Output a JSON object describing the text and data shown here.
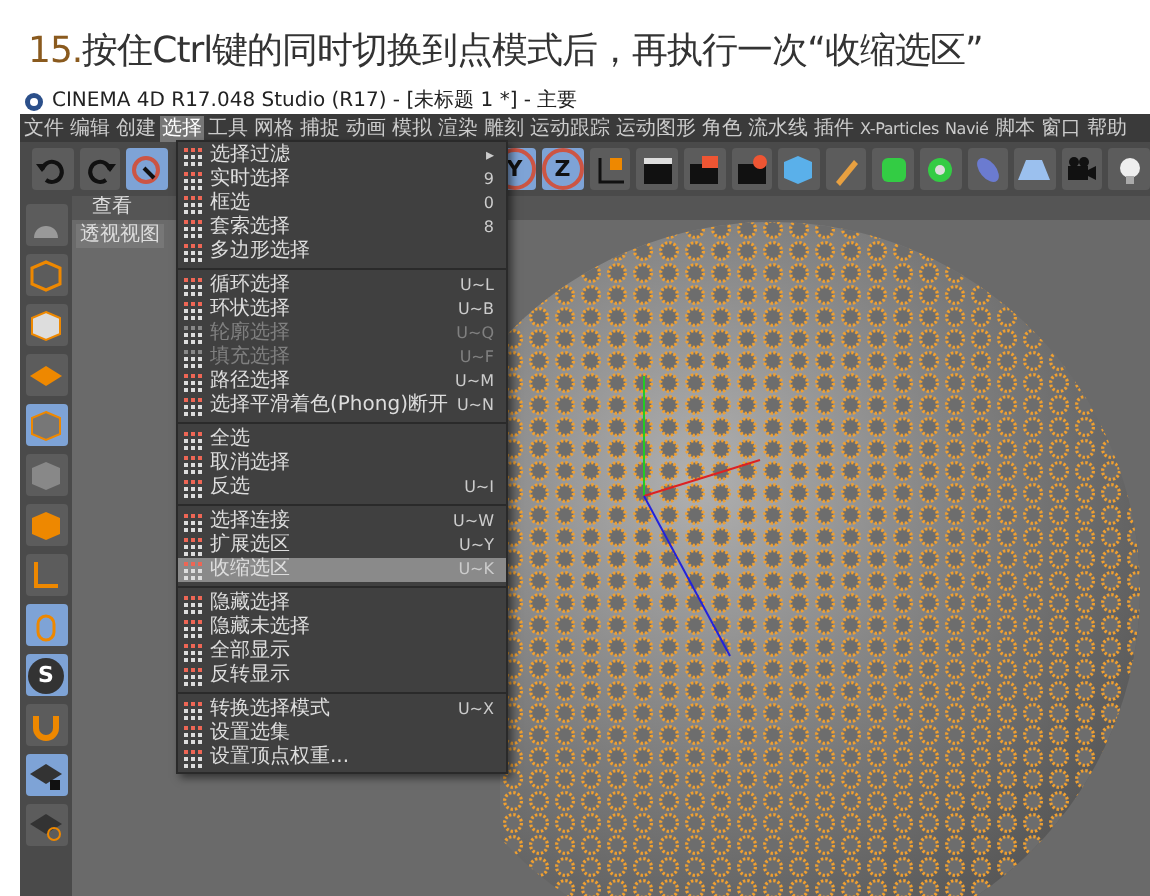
{
  "heading": {
    "step_number": "15.",
    "text": "按住Ctrl键的同时切换到点模式后，再执行一次“收缩选区”"
  },
  "window": {
    "title": "CINEMA 4D R17.048 Studio (R17) - [未标题 1 *] - 主要"
  },
  "menubar": [
    {
      "label": "文件",
      "selected": false
    },
    {
      "label": "编辑",
      "selected": false
    },
    {
      "label": "创建",
      "selected": false
    },
    {
      "label": "选择",
      "selected": true
    },
    {
      "label": "工具",
      "selected": false
    },
    {
      "label": "网格",
      "selected": false
    },
    {
      "label": "捕捉",
      "selected": false
    },
    {
      "label": "动画",
      "selected": false
    },
    {
      "label": "模拟",
      "selected": false
    },
    {
      "label": "渲染",
      "selected": false
    },
    {
      "label": "雕刻",
      "selected": false
    },
    {
      "label": "运动跟踪",
      "selected": false
    },
    {
      "label": "运动图形",
      "selected": false
    },
    {
      "label": "角色",
      "selected": false
    },
    {
      "label": "流水线",
      "selected": false
    },
    {
      "label": "插件",
      "selected": false
    },
    {
      "label": "X-Particles",
      "selected": false
    },
    {
      "label": "Navié",
      "selected": false
    },
    {
      "label": "脚本",
      "selected": false
    },
    {
      "label": "窗口",
      "selected": false
    },
    {
      "label": "帮助",
      "selected": false
    }
  ],
  "viewport": {
    "tab": "查看",
    "label": "透视视图"
  },
  "toolbar": {
    "axis_letters": [
      "Y",
      "Z"
    ]
  },
  "tools": {
    "snap_letter": "S"
  },
  "menu": [
    [
      {
        "label": "选择过滤",
        "shortcut": "▸",
        "disabled": false,
        "selected": false
      },
      {
        "label": "实时选择",
        "shortcut": "9",
        "disabled": false,
        "selected": false
      },
      {
        "label": "框选",
        "shortcut": "0",
        "disabled": false,
        "selected": false
      },
      {
        "label": "套索选择",
        "shortcut": "8",
        "disabled": false,
        "selected": false
      },
      {
        "label": "多边形选择",
        "disabled": false,
        "selected": false
      }
    ],
    [
      {
        "label": "循环选择",
        "shortcut": "U~L",
        "disabled": false,
        "selected": false
      },
      {
        "label": "环状选择",
        "shortcut": "U~B",
        "disabled": false,
        "selected": false
      },
      {
        "label": "轮廓选择",
        "shortcut": "U~Q",
        "disabled": true,
        "selected": false
      },
      {
        "label": "填充选择",
        "shortcut": "U~F",
        "disabled": true,
        "selected": false
      },
      {
        "label": "路径选择",
        "shortcut": "U~M",
        "disabled": false,
        "selected": false
      },
      {
        "label": "选择平滑着色(Phong)断开",
        "shortcut": "U~N",
        "disabled": false,
        "selected": false
      }
    ],
    [
      {
        "label": "全选",
        "disabled": false,
        "selected": false
      },
      {
        "label": "取消选择",
        "disabled": false,
        "selected": false
      },
      {
        "label": "反选",
        "shortcut": "U~I",
        "disabled": false,
        "selected": false
      }
    ],
    [
      {
        "label": "选择连接",
        "shortcut": "U~W",
        "disabled": false,
        "selected": false
      },
      {
        "label": "扩展选区",
        "shortcut": "U~Y",
        "disabled": false,
        "selected": false
      },
      {
        "label": "收缩选区",
        "shortcut": "U~K",
        "disabled": false,
        "selected": true
      }
    ],
    [
      {
        "label": "隐藏选择",
        "disabled": false,
        "selected": false
      },
      {
        "label": "隐藏未选择",
        "disabled": false,
        "selected": false
      },
      {
        "label": "全部显示",
        "disabled": false,
        "selected": false
      },
      {
        "label": "反转显示",
        "disabled": false,
        "selected": false
      }
    ],
    [
      {
        "label": "转换选择模式",
        "shortcut": "U~X",
        "disabled": false,
        "selected": false
      },
      {
        "label": "设置选集",
        "disabled": false,
        "selected": false
      },
      {
        "label": "设置顶点权重...",
        "disabled": false,
        "selected": false
      }
    ]
  ]
}
